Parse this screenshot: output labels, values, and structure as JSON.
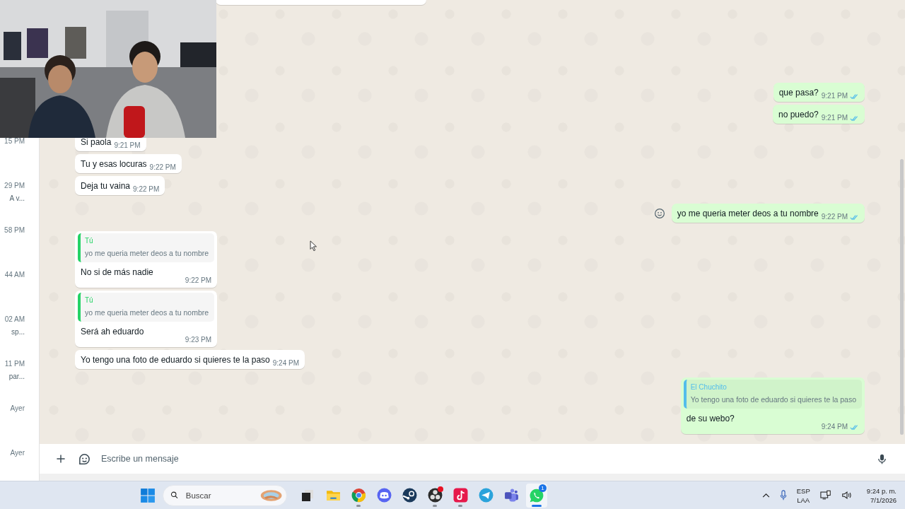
{
  "sidebar": {
    "chats": [
      {
        "time": "15 PM"
      },
      {
        "time": "29 PM",
        "preview": "A v..."
      },
      {
        "time": "58 PM"
      },
      {
        "time": "44 AM"
      },
      {
        "time": "02 AM",
        "preview": "sp..."
      },
      {
        "time": "11 PM",
        "preview": "par..."
      },
      {
        "time": "Ayer"
      },
      {
        "time": "Ayer"
      }
    ]
  },
  "conversation": {
    "groups": [
      {
        "kind": "outgoing",
        "messages": [
          {
            "text": "que pasa?",
            "time": "9:21 PM",
            "read": true
          },
          {
            "text": "no puedo?",
            "time": "9:21 PM",
            "read": true
          }
        ]
      },
      {
        "kind": "incoming",
        "messages": [
          {
            "text": "Si paola",
            "time": "9:21 PM"
          },
          {
            "text": "Tu y esas locuras",
            "time": "9:22 PM"
          },
          {
            "text": "Deja tu vaina",
            "time": "9:22 PM"
          }
        ]
      },
      {
        "kind": "outgoing",
        "messages": [
          {
            "text": "yo me queria meter deos a tu nombre",
            "time": "9:22 PM",
            "read": true,
            "reaction_button": true
          }
        ]
      },
      {
        "kind": "incoming",
        "messages": [
          {
            "quote": {
              "author": "Tú",
              "text": "yo me queria meter deos a tu nombre",
              "color": "#25d366"
            },
            "text": "No si de más nadie",
            "time": "9:22 PM"
          },
          {
            "quote": {
              "author": "Tú",
              "text": "yo me queria meter deos a tu nombre",
              "color": "#25d366"
            },
            "text": "Será ah eduardo",
            "time": "9:23 PM"
          },
          {
            "text": "Yo tengo una foto de eduardo si quieres te la paso",
            "time": "9:24 PM"
          }
        ]
      },
      {
        "kind": "outgoing",
        "messages": [
          {
            "quote": {
              "author": "El Chuchito",
              "text": "Yo tengo una foto de eduardo si quieres te la paso",
              "color": "#53bdeb"
            },
            "text": "de su webo?",
            "time": "9:24 PM",
            "read": true
          }
        ]
      }
    ]
  },
  "composer": {
    "placeholder": "Escribe un mensaje"
  },
  "taskbar": {
    "search": {
      "placeholder": "Buscar"
    },
    "apps": [
      {
        "kind": "taskview",
        "running": false,
        "selected": false
      },
      {
        "kind": "folder",
        "running": false,
        "selected": false
      },
      {
        "kind": "browser",
        "running": true,
        "selected": false
      },
      {
        "kind": "discord",
        "running": false,
        "selected": false
      },
      {
        "kind": "steam",
        "running": false,
        "selected": false
      },
      {
        "kind": "obs",
        "running": true,
        "selected": false,
        "notification_dot": true
      },
      {
        "kind": "tiktok",
        "running": true,
        "selected": false
      },
      {
        "kind": "telegram",
        "running": false,
        "selected": false
      },
      {
        "kind": "teams",
        "running": false,
        "selected": false
      },
      {
        "kind": "whatsapp",
        "running": true,
        "selected": true,
        "badge": "1"
      }
    ],
    "tray": {
      "language": "ESP",
      "layout": "LAA",
      "time": "9:24 p. m.",
      "date": "7/1/2026"
    }
  }
}
